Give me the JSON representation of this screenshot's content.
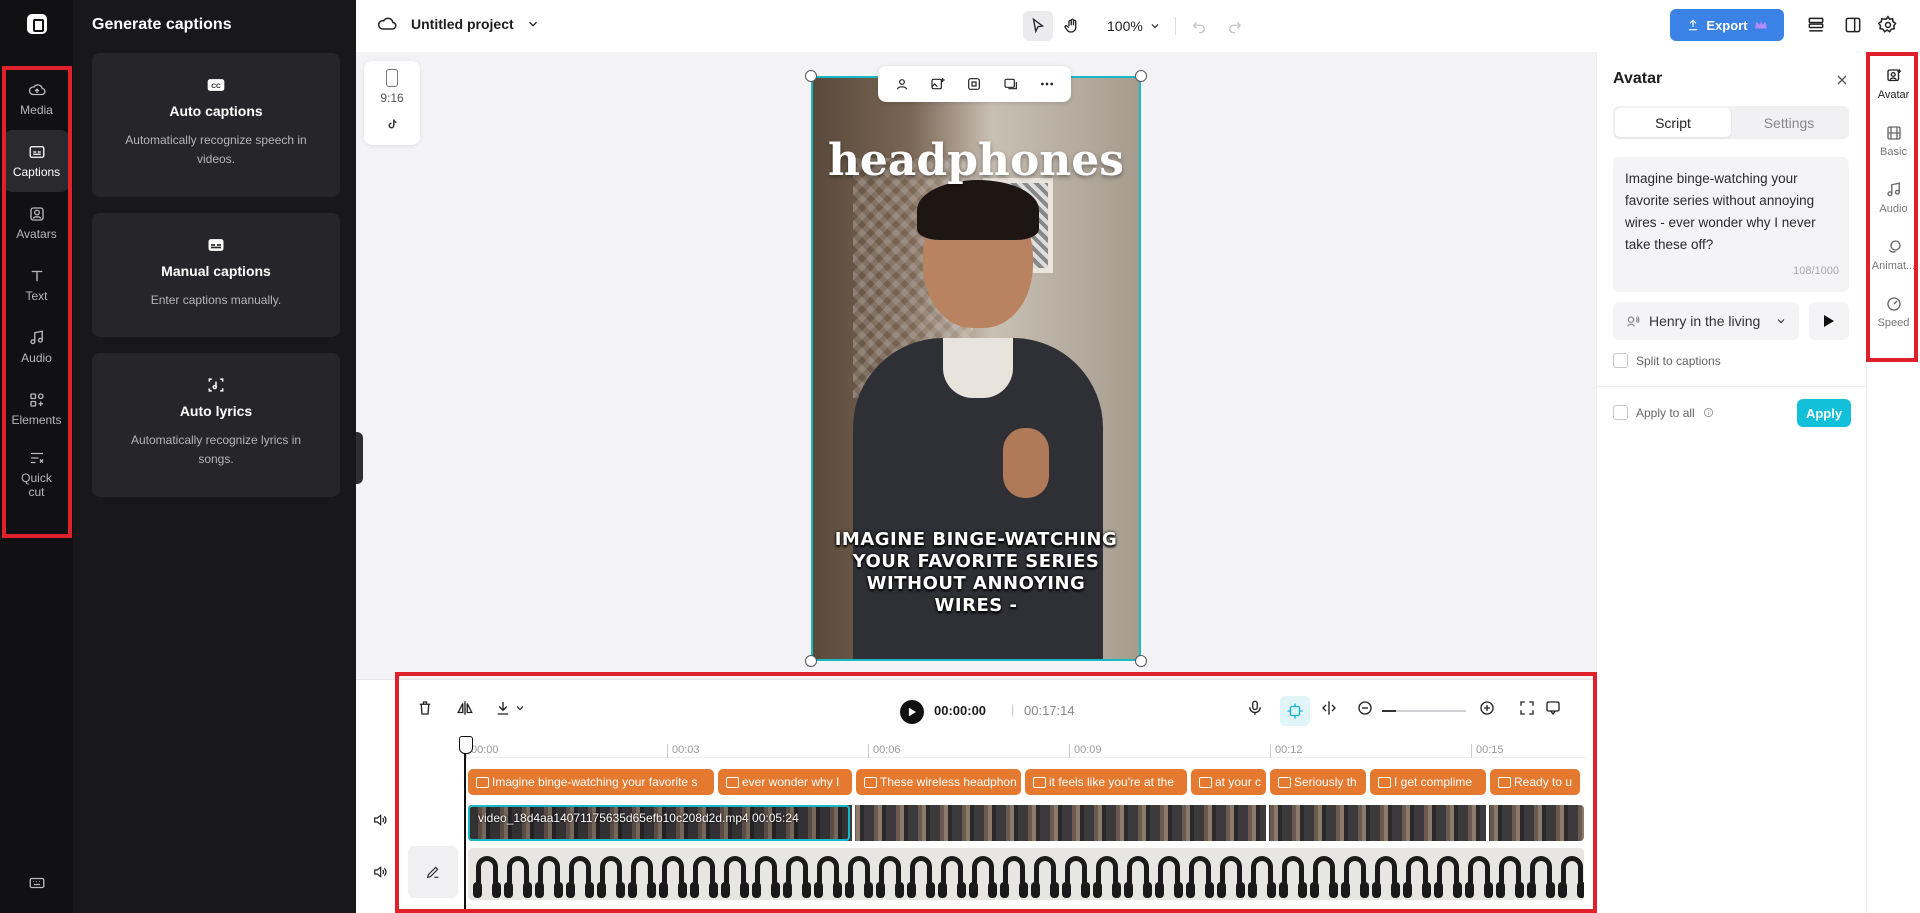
{
  "left_rail": {
    "items": [
      {
        "label": "Media",
        "icon": "cloud-upload-icon"
      },
      {
        "label": "Captions",
        "icon": "captions-icon",
        "active": true
      },
      {
        "label": "Avatars",
        "icon": "avatar-icon"
      },
      {
        "label": "Text",
        "icon": "text-icon"
      },
      {
        "label": "Audio",
        "icon": "music-note-icon"
      },
      {
        "label": "Elements",
        "icon": "elements-icon"
      },
      {
        "label": "Quick\ncut",
        "icon": "quick-cut-icon"
      }
    ]
  },
  "captions_panel": {
    "title": "Generate captions",
    "cards": [
      {
        "title": "Auto captions",
        "desc": "Automatically recognize speech in videos."
      },
      {
        "title": "Manual captions",
        "desc": "Enter captions manually."
      },
      {
        "title": "Auto lyrics",
        "desc": "Automatically recognize lyrics in songs."
      }
    ]
  },
  "header": {
    "project_title": "Untitled project",
    "zoom": "100%",
    "export_label": "Export"
  },
  "canvas": {
    "ratio": "9:16",
    "video_title": "headphones",
    "video_caption": "IMAGINE BINGE-WATCHING YOUR FAVORITE SERIES WITHOUT ANNOYING WIRES -"
  },
  "avatar_panel": {
    "title": "Avatar",
    "tabs": [
      "Script",
      "Settings"
    ],
    "script": "Imagine binge-watching your favorite series without annoying wires - ever wonder why I never take these off?",
    "char_count": "108/1000",
    "voice": "Henry in the living",
    "split_label": "Split to captions",
    "apply_all_label": "Apply to all",
    "apply_label": "Apply"
  },
  "right_rail": {
    "items": [
      {
        "label": "Avatar",
        "active": true
      },
      {
        "label": "Basic"
      },
      {
        "label": "Audio"
      },
      {
        "label": "Animat..."
      },
      {
        "label": "Speed"
      }
    ]
  },
  "timeline": {
    "current_time": "00:00:00",
    "total_time": "00:17:14",
    "ticks": [
      "00:00",
      "00:03",
      "00:06",
      "00:09",
      "00:12",
      "00:15"
    ],
    "caption_clips": [
      "Imagine binge-watching your favorite s",
      "ever wonder why I",
      "These wireless headphon",
      "it feels like you're at the",
      "at your c",
      "Seriously th",
      "I get complime",
      "Ready to u"
    ],
    "video_clip_label": "video_18d4aa14071175635d65efb10c208d2d.mp4   00:05:24"
  }
}
